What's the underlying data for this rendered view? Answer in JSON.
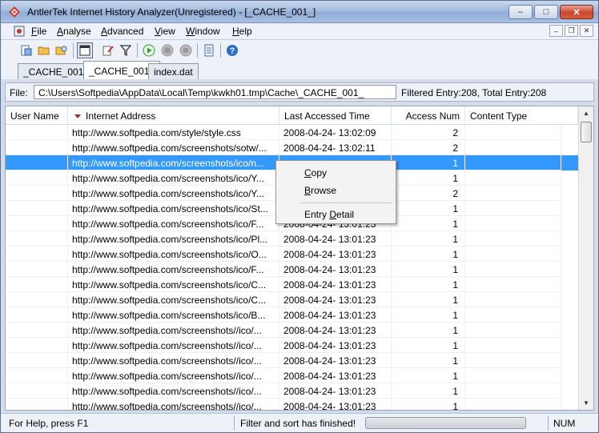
{
  "window": {
    "title": "AntlerTek Internet History Analyzer(Unregistered) - [_CACHE_001_]",
    "minimize_glyph": "–",
    "maximize_glyph": "□",
    "close_glyph": "✕"
  },
  "menu": {
    "items": [
      {
        "label": "File",
        "ul": "F",
        "rest": "ile"
      },
      {
        "label": "Analyse",
        "ul": "A",
        "rest": "nalyse"
      },
      {
        "label": "Advanced",
        "ul": "A",
        "rest": "dvanced"
      },
      {
        "label": "View",
        "ul": "V",
        "rest": "iew"
      },
      {
        "label": "Window",
        "ul": "W",
        "rest": "indow"
      },
      {
        "label": "Help",
        "ul": "H",
        "rest": "elp"
      }
    ],
    "mdi_minimize": "–",
    "mdi_restore": "❐",
    "mdi_close": "✕"
  },
  "tabs": [
    "_CACHE_001_",
    "_CACHE_001_",
    "index.dat"
  ],
  "active_tab_index": 1,
  "filebar": {
    "label": "File:",
    "path": "C:\\Users\\Softpedia\\AppData\\Local\\Temp\\kwkh01.tmp\\Cache\\_CACHE_001_",
    "filter_text": "Filtered Entry:208, Total Entry:208"
  },
  "grid": {
    "columns": [
      "User Name",
      "Internet Address",
      "Last Accessed Time",
      "Access Num",
      "Content Type"
    ],
    "sort_column": "Internet Address",
    "selected_row_index": 2,
    "rows": [
      {
        "user": "",
        "address": "http://www.softpedia.com/style/style.css",
        "time": "2008-04-24- 13:02:09",
        "num": "2",
        "type": ""
      },
      {
        "user": "",
        "address": "http://www.softpedia.com/screenshots/sotw/...",
        "time": "2008-04-24- 13:02:11",
        "num": "2",
        "type": ""
      },
      {
        "user": "",
        "address": "http://www.softpedia.com/screenshots/ico/n...",
        "time": "",
        "num": "1",
        "type": ""
      },
      {
        "user": "",
        "address": "http://www.softpedia.com/screenshots/ico/Y...",
        "time": "",
        "num": "1",
        "type": ""
      },
      {
        "user": "",
        "address": "http://www.softpedia.com/screenshots/ico/Y...",
        "time": "",
        "num": "2",
        "type": ""
      },
      {
        "user": "",
        "address": "http://www.softpedia.com/screenshots/ico/St...",
        "time": "",
        "num": "1",
        "type": ""
      },
      {
        "user": "",
        "address": "http://www.softpedia.com/screenshots/ico/F...",
        "time": "2008-04-24- 13:01:23",
        "num": "1",
        "type": ""
      },
      {
        "user": "",
        "address": "http://www.softpedia.com/screenshots/ico/Pl...",
        "time": "2008-04-24- 13:01:23",
        "num": "1",
        "type": ""
      },
      {
        "user": "",
        "address": "http://www.softpedia.com/screenshots/ico/O...",
        "time": "2008-04-24- 13:01:23",
        "num": "1",
        "type": ""
      },
      {
        "user": "",
        "address": "http://www.softpedia.com/screenshots/ico/F...",
        "time": "2008-04-24- 13:01:23",
        "num": "1",
        "type": ""
      },
      {
        "user": "",
        "address": "http://www.softpedia.com/screenshots/ico/C...",
        "time": "2008-04-24- 13:01:23",
        "num": "1",
        "type": ""
      },
      {
        "user": "",
        "address": "http://www.softpedia.com/screenshots/ico/C...",
        "time": "2008-04-24- 13:01:23",
        "num": "1",
        "type": ""
      },
      {
        "user": "",
        "address": "http://www.softpedia.com/screenshots/ico/B...",
        "time": "2008-04-24- 13:01:23",
        "num": "1",
        "type": ""
      },
      {
        "user": "",
        "address": "http://www.softpedia.com/screenshots//ico/...",
        "time": "2008-04-24- 13:01:23",
        "num": "1",
        "type": ""
      },
      {
        "user": "",
        "address": "http://www.softpedia.com/screenshots//ico/...",
        "time": "2008-04-24- 13:01:23",
        "num": "1",
        "type": ""
      },
      {
        "user": "",
        "address": "http://www.softpedia.com/screenshots//ico/...",
        "time": "2008-04-24- 13:01:23",
        "num": "1",
        "type": ""
      },
      {
        "user": "",
        "address": "http://www.softpedia.com/screenshots//ico/...",
        "time": "2008-04-24- 13:01:23",
        "num": "1",
        "type": ""
      },
      {
        "user": "",
        "address": "http://www.softpedia.com/screenshots//ico/...",
        "time": "2008-04-24- 13:01:23",
        "num": "1",
        "type": ""
      },
      {
        "user": "",
        "address": "http://www.softpedia.com/screenshots//ico/...",
        "time": "2008-04-24- 13:01:23",
        "num": "1",
        "type": ""
      }
    ]
  },
  "context_menu": {
    "items": [
      {
        "label": "Copy",
        "ul": "C",
        "rest": "opy"
      },
      {
        "label": "Browse",
        "ul": "B",
        "rest": "rowse"
      },
      {
        "label": "Entry Detail",
        "pre": "Entry ",
        "ul": "D",
        "rest": "etail"
      }
    ]
  },
  "statusbar": {
    "help": "For Help, press F1",
    "message": "Filter and sort has finished!",
    "num": "NUM"
  },
  "colors": {
    "selection": "#3399ff",
    "titlebar": "#9fb8dc",
    "sort_arrow": "#a52a2a",
    "play_green": "#2e9e2e"
  }
}
